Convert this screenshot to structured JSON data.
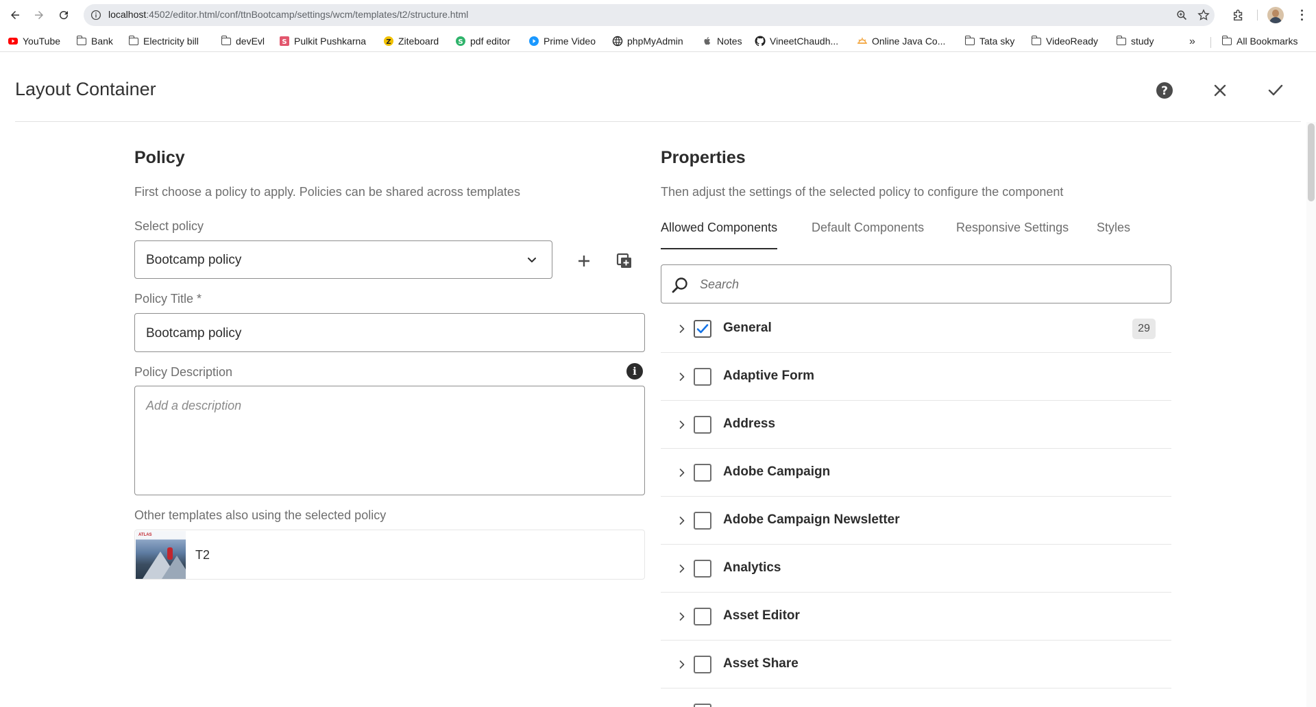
{
  "browser": {
    "url_host": "localhost",
    "url_path": ":4502/editor.html/conf/ttnBootcamp/settings/wcm/templates/t2/structure.html",
    "bookmarks": [
      {
        "label": "YouTube",
        "icon": "youtube-icon"
      },
      {
        "label": "Bank",
        "icon": "folder-icon"
      },
      {
        "label": "Electricity bill",
        "icon": "folder-icon"
      },
      {
        "label": "devEvl",
        "icon": "folder-icon"
      },
      {
        "label": "Pulkit Pushkarna",
        "icon": "site-s-icon"
      },
      {
        "label": "Ziteboard",
        "icon": "ziteboard-icon"
      },
      {
        "label": "pdf editor",
        "icon": "sejda-icon"
      },
      {
        "label": "Prime Video",
        "icon": "prime-video-icon"
      },
      {
        "label": "phpMyAdmin",
        "icon": "globe-icon"
      },
      {
        "label": "Notes",
        "icon": "apple-icon"
      },
      {
        "label": "VineetChaudh...",
        "icon": "github-icon"
      },
      {
        "label": "Online Java Co...",
        "icon": "sun-icon"
      },
      {
        "label": "Tata sky",
        "icon": "folder-icon"
      },
      {
        "label": "VideoReady",
        "icon": "folder-icon"
      },
      {
        "label": "study",
        "icon": "folder-icon"
      }
    ],
    "more_bookmarks": "»",
    "all_bookmarks": "All Bookmarks"
  },
  "dialog": {
    "title": "Layout Container",
    "help_icon": "help-icon",
    "close_icon": "close-icon",
    "confirm_icon": "checkmark-icon"
  },
  "policy": {
    "heading": "Policy",
    "description": "First choose a policy to apply. Policies can be shared across templates",
    "select_label": "Select policy",
    "selected_policy": "Bootcamp policy",
    "title_label": "Policy Title *",
    "title_value": "Bootcamp policy",
    "description_label": "Policy Description",
    "description_placeholder": "Add a description",
    "other_templates_label": "Other templates also using the selected policy",
    "templates": [
      {
        "name": "T2",
        "thumb_brand": "ATLAS"
      }
    ]
  },
  "properties": {
    "heading": "Properties",
    "description": "Then adjust the settings of the selected policy to configure the component",
    "tabs": [
      {
        "label": "Allowed Components",
        "active": true
      },
      {
        "label": "Default Components",
        "active": false
      },
      {
        "label": "Responsive Settings",
        "active": false
      },
      {
        "label": "Styles",
        "active": false
      }
    ],
    "search_placeholder": "Search",
    "components": [
      {
        "label": "General",
        "checked": true,
        "count": "29"
      },
      {
        "label": "Adaptive Form",
        "checked": false
      },
      {
        "label": "Address",
        "checked": false
      },
      {
        "label": "Adobe Campaign",
        "checked": false
      },
      {
        "label": "Adobe Campaign Newsletter",
        "checked": false
      },
      {
        "label": "Analytics",
        "checked": false
      },
      {
        "label": "Asset Editor",
        "checked": false
      },
      {
        "label": "Asset Share",
        "checked": false
      }
    ]
  }
}
